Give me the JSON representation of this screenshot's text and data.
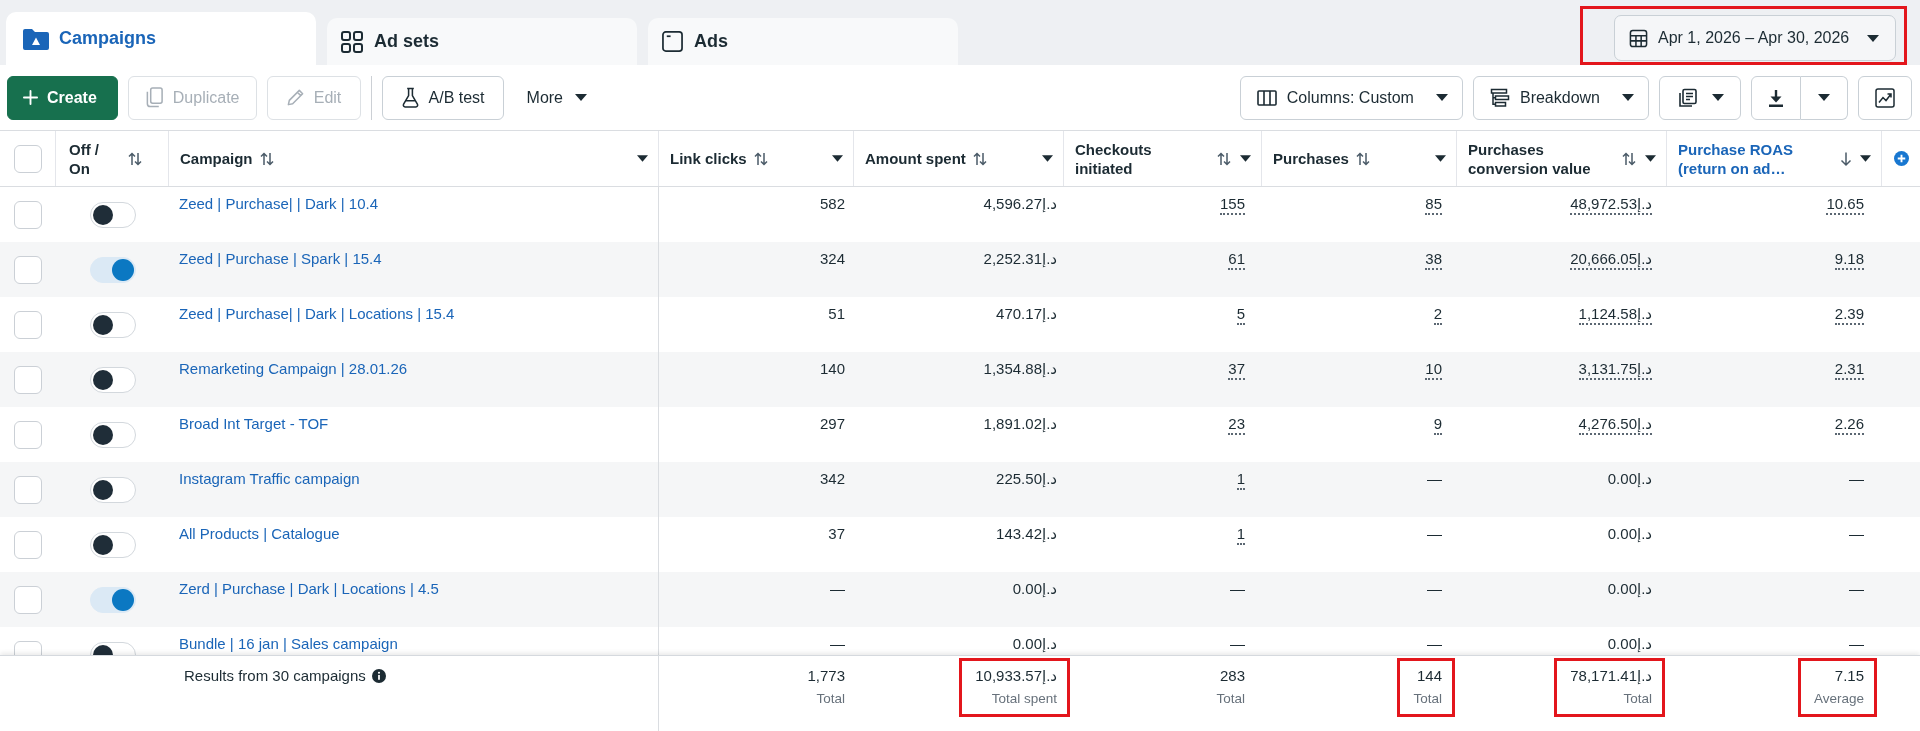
{
  "tabs": [
    {
      "label": "Campaigns",
      "selected": true
    },
    {
      "label": "Ad sets",
      "selected": false
    },
    {
      "label": "Ads",
      "selected": false
    }
  ],
  "date_range": {
    "label": "Apr 1, 2026 – Apr 30, 2026",
    "highlighted": true
  },
  "toolbar": {
    "groups": [
      [
        {
          "kind": "primary",
          "label": "Create",
          "disabled": false
        },
        {
          "kind": "secondary",
          "label": "Duplicate",
          "disabled": true
        },
        {
          "kind": "secondary",
          "label": "Edit",
          "disabled": true
        }
      ],
      [
        {
          "kind": "secondary",
          "label": "A/B test",
          "disabled": false
        },
        {
          "kind": "menu",
          "label": "More",
          "disabled": false
        }
      ]
    ],
    "right": [
      {
        "kind": "dropdown",
        "label": "Columns: Custom"
      },
      {
        "kind": "dropdown",
        "label": "Breakdown"
      },
      {
        "kind": "icon_dropdown"
      },
      {
        "kind": "split"
      },
      {
        "kind": "icon"
      }
    ]
  },
  "table": {
    "select_all": {
      "checked": false
    },
    "columns": [
      {
        "label": "Off / On",
        "sorted": false,
        "menu": false
      },
      {
        "label": "Campaign",
        "sorted": false,
        "menu": true
      },
      {
        "label": "Link clicks",
        "sorted": false,
        "menu": true
      },
      {
        "label": "Amount spent",
        "sorted": false,
        "menu": true
      },
      {
        "label": "Checkouts initiated",
        "sorted": false,
        "menu": true
      },
      {
        "label": "Purchases",
        "sorted": false,
        "menu": true
      },
      {
        "label": "Purchases conversion value",
        "sorted": false,
        "menu": true
      },
      {
        "label": "Purchase ROAS (return on ad…",
        "sorted": true,
        "menu": true
      }
    ],
    "rows": [
      {
        "checked": false,
        "on": false,
        "name": "Zeed | Purchase| | Dark | 10.4",
        "values": [
          {
            "text": "582",
            "linked": false
          },
          {
            "text": "د.إ4,596.27",
            "linked": false
          },
          {
            "text": "155",
            "linked": true
          },
          {
            "text": "85",
            "linked": true
          },
          {
            "text": "د.إ48,972.53",
            "linked": true
          },
          {
            "text": "10.65",
            "linked": true
          }
        ]
      },
      {
        "checked": false,
        "on": true,
        "name": "Zeed | Purchase | Spark | 15.4",
        "values": [
          {
            "text": "324",
            "linked": false
          },
          {
            "text": "د.إ2,252.31",
            "linked": false
          },
          {
            "text": "61",
            "linked": true
          },
          {
            "text": "38",
            "linked": true
          },
          {
            "text": "د.إ20,666.05",
            "linked": true
          },
          {
            "text": "9.18",
            "linked": true
          }
        ]
      },
      {
        "checked": false,
        "on": false,
        "name": "Zeed | Purchase| | Dark | Locations | 15.4",
        "values": [
          {
            "text": "51",
            "linked": false
          },
          {
            "text": "د.إ470.17",
            "linked": false
          },
          {
            "text": "5",
            "linked": true
          },
          {
            "text": "2",
            "linked": true
          },
          {
            "text": "د.إ1,124.58",
            "linked": true
          },
          {
            "text": "2.39",
            "linked": true
          }
        ]
      },
      {
        "checked": false,
        "on": false,
        "name": "Remarketing Campaign | 28.01.26",
        "values": [
          {
            "text": "140",
            "linked": false
          },
          {
            "text": "د.إ1,354.88",
            "linked": false
          },
          {
            "text": "37",
            "linked": true
          },
          {
            "text": "10",
            "linked": true
          },
          {
            "text": "د.إ3,131.75",
            "linked": true
          },
          {
            "text": "2.31",
            "linked": true
          }
        ]
      },
      {
        "checked": false,
        "on": false,
        "name": "Broad Int Target - TOF",
        "values": [
          {
            "text": "297",
            "linked": false
          },
          {
            "text": "د.إ1,891.02",
            "linked": false
          },
          {
            "text": "23",
            "linked": true
          },
          {
            "text": "9",
            "linked": true
          },
          {
            "text": "د.إ4,276.50",
            "linked": true
          },
          {
            "text": "2.26",
            "linked": true
          }
        ]
      },
      {
        "checked": false,
        "on": false,
        "name": "Instagram Traffic campaign",
        "values": [
          {
            "text": "342",
            "linked": false
          },
          {
            "text": "د.إ225.50",
            "linked": false
          },
          {
            "text": "1",
            "linked": true
          },
          {
            "text": "—",
            "linked": false
          },
          {
            "text": "د.إ0.00",
            "linked": false
          },
          {
            "text": "—",
            "linked": false
          }
        ]
      },
      {
        "checked": false,
        "on": false,
        "name": "All Products | Catalogue",
        "values": [
          {
            "text": "37",
            "linked": false
          },
          {
            "text": "د.إ143.42",
            "linked": false
          },
          {
            "text": "1",
            "linked": true
          },
          {
            "text": "—",
            "linked": false
          },
          {
            "text": "د.إ0.00",
            "linked": false
          },
          {
            "text": "—",
            "linked": false
          }
        ]
      },
      {
        "checked": false,
        "on": true,
        "name": "Zerd | Purchase | Dark | Locations | 4.5",
        "values": [
          {
            "text": "—",
            "linked": false
          },
          {
            "text": "د.إ0.00",
            "linked": false
          },
          {
            "text": "—",
            "linked": false
          },
          {
            "text": "—",
            "linked": false
          },
          {
            "text": "د.إ0.00",
            "linked": false
          },
          {
            "text": "—",
            "linked": false
          }
        ]
      },
      {
        "checked": false,
        "on": false,
        "name": "Bundle | 16 jan | Sales campaign",
        "values": [
          {
            "text": "—",
            "linked": false
          },
          {
            "text": "د.إ0.00",
            "linked": false
          },
          {
            "text": "—",
            "linked": false
          },
          {
            "text": "—",
            "linked": false
          },
          {
            "text": "د.إ0.00",
            "linked": false
          },
          {
            "text": "—",
            "linked": false
          }
        ]
      }
    ],
    "footer": {
      "summary": "Results from 30 campaigns",
      "totals": [
        {
          "value": "1,773",
          "label": "Total",
          "highlighted": false
        },
        {
          "value": "د.إ10,933.57",
          "label": "Total spent",
          "highlighted": true
        },
        {
          "value": "283",
          "label": "Total",
          "highlighted": false
        },
        {
          "value": "144",
          "label": "Total",
          "highlighted": true
        },
        {
          "value": "د.إ78,171.41",
          "label": "Total",
          "highlighted": true
        },
        {
          "value": "7.15",
          "label": "Average",
          "highlighted": true
        }
      ]
    }
  }
}
